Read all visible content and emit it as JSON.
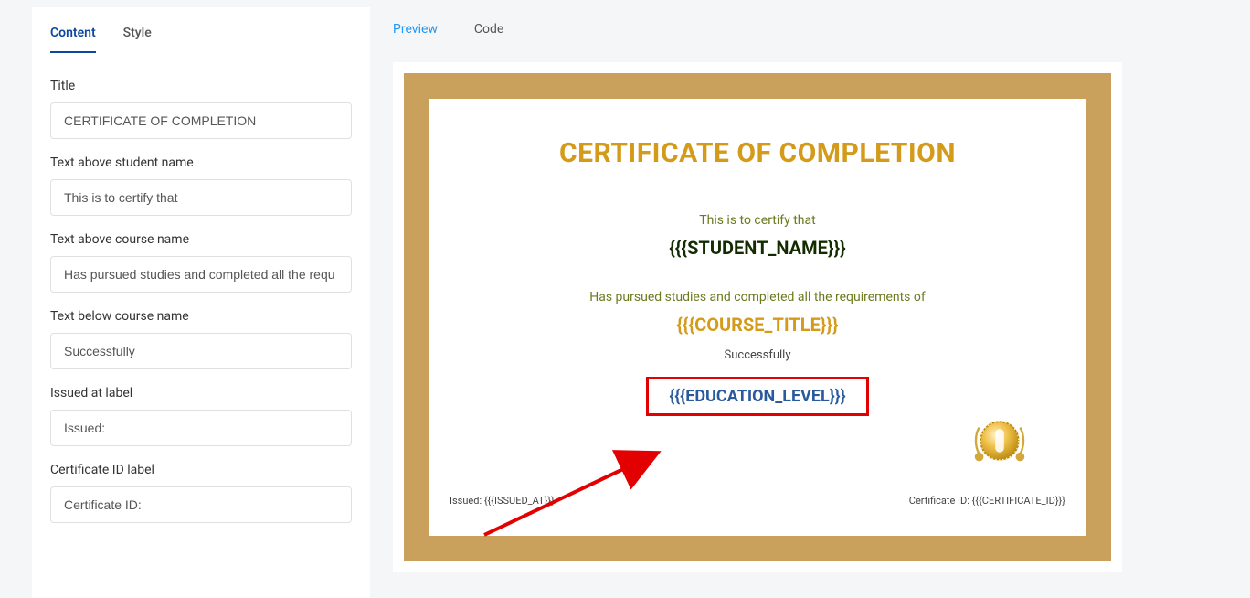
{
  "sidebar": {
    "tabs": {
      "content": "Content",
      "style": "Style"
    },
    "fields": {
      "title": {
        "label": "Title",
        "value": "CERTIFICATE OF COMPLETION"
      },
      "text_above_name": {
        "label": "Text above student name",
        "value": "This is to certify that"
      },
      "text_above_course": {
        "label": "Text above course name",
        "value": "Has pursued studies and completed all the requ"
      },
      "text_below_course": {
        "label": "Text below course name",
        "value": "Successfully"
      },
      "issued_label": {
        "label": "Issued at label",
        "value": "Issued:"
      },
      "cert_id_label": {
        "label": "Certificate ID label",
        "value": "Certificate ID:"
      }
    }
  },
  "main": {
    "tabs": {
      "preview": "Preview",
      "code": "Code"
    }
  },
  "certificate": {
    "title": "CERTIFICATE OF COMPLETION",
    "text_above_name": "This is to certify that",
    "student_name": "{{{STUDENT_NAME}}}",
    "text_above_course": "Has pursued studies and completed all the requirements of",
    "course_title": "{{{COURSE_TITLE}}}",
    "text_below_course": "Successfully",
    "education_level": "{{{EDUCATION_LEVEL}}}",
    "issued": "Issued: {{{ISSUED_AT}}}",
    "certificate_id": "Certificate ID: {{{CERTIFICATE_ID}}}"
  }
}
